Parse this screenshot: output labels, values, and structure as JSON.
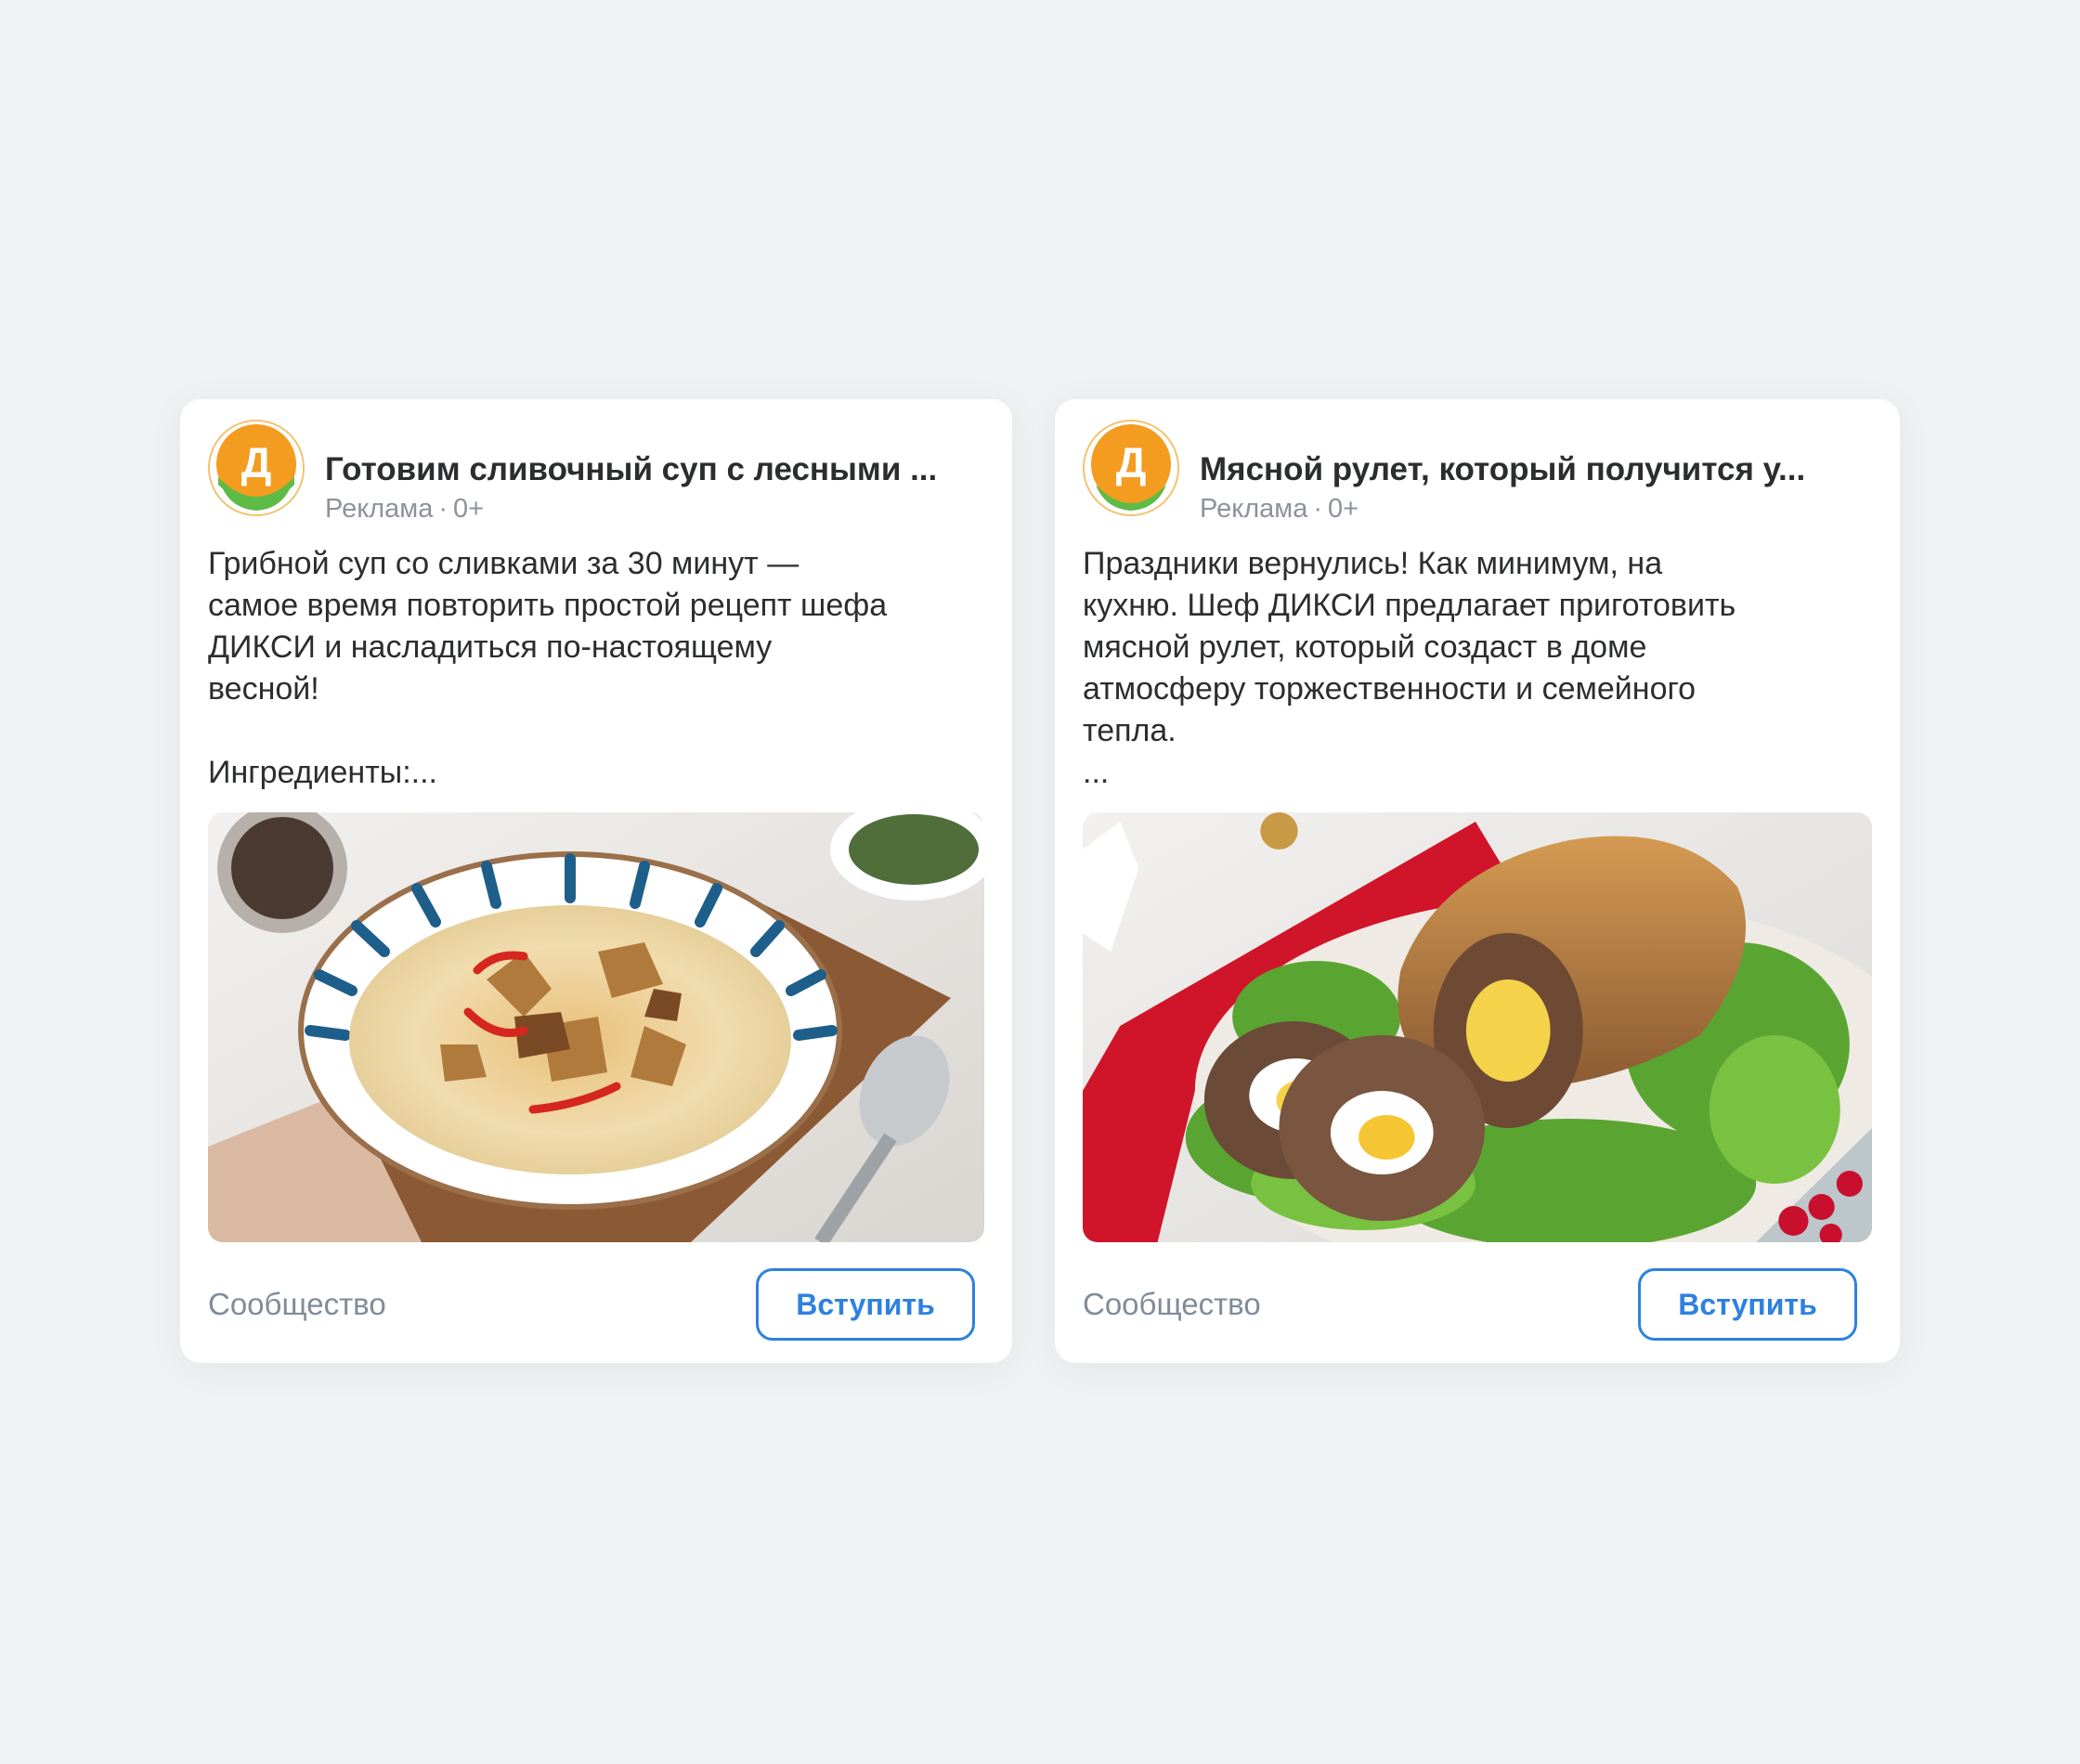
{
  "brand": {
    "logo_letter": "Д",
    "accent_orange": "#f39c1f",
    "accent_green": "#5dbb46",
    "link_blue": "#2d81e0"
  },
  "ads": [
    {
      "title": "Готовим сливочный суп с лесными ...",
      "meta_label": "Реклама",
      "age_rating": "0+",
      "text": "Грибной суп со сливками за 30 минут —\nсамое время повторить простой рецепт шефа\nДИКСИ и насладиться по-настоящему\nвесной!\n\nИнгредиенты:...",
      "image_icon": "mushroom-soup-photo",
      "footer_label": "Сообщество",
      "button_label": "Вступить"
    },
    {
      "title": "Мясной рулет, который получится у...",
      "meta_label": "Реклама",
      "age_rating": "0+",
      "text": "Праздники вернулись! Как минимум, на\nкухню. Шеф ДИКСИ предлагает приготовить\nмясной рулет, который создаст в доме\nатмосферу торжественности и семейного\nтепла.\n...",
      "image_icon": "meat-roll-photo",
      "footer_label": "Сообщество",
      "button_label": "Вступить"
    }
  ]
}
